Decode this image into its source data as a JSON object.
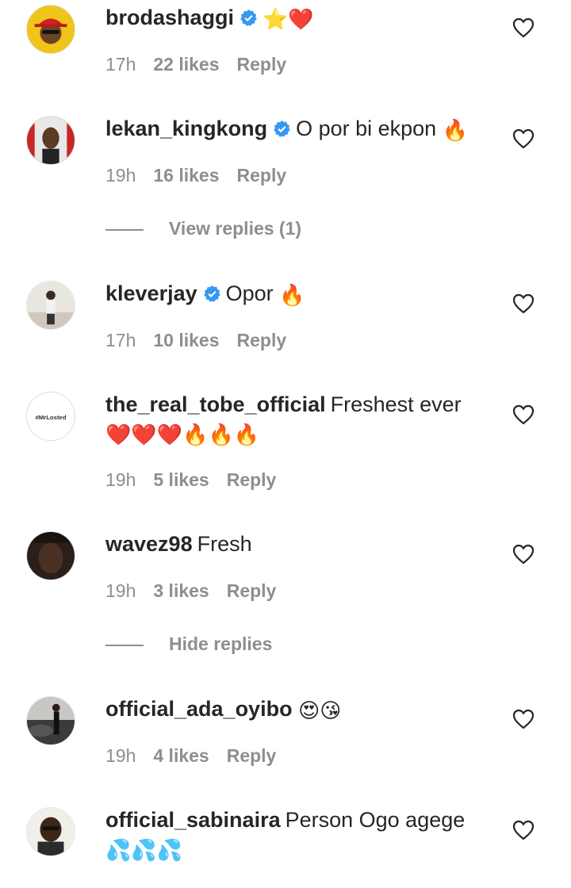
{
  "comments": [
    {
      "username": "brodashaggi",
      "verified": true,
      "text": "",
      "emoji": "⭐❤️",
      "emoji_line2": "",
      "time": "17h",
      "likes": "22 likes",
      "reply": "Reply"
    },
    {
      "username": "lekan_kingkong",
      "verified": true,
      "text": "O por bi ekpon",
      "emoji": "🔥",
      "emoji_line2": "",
      "time": "19h",
      "likes": "16 likes",
      "reply": "Reply"
    },
    {
      "username": "kleverjay",
      "verified": true,
      "text": "Opor",
      "emoji": "🔥",
      "emoji_line2": "",
      "time": "17h",
      "likes": "10 likes",
      "reply": "Reply"
    },
    {
      "username": "the_real_tobe_official",
      "verified": false,
      "text": "Freshest ever",
      "emoji": "",
      "emoji_line2": "❤️❤️❤️🔥🔥🔥",
      "time": "19h",
      "likes": "5 likes",
      "reply": "Reply",
      "avatar_text": "#MrLosted"
    },
    {
      "username": "wavez98",
      "verified": false,
      "text": "Fresh",
      "emoji": "",
      "emoji_line2": "",
      "time": "19h",
      "likes": "3 likes",
      "reply": "Reply"
    },
    {
      "username": "official_ada_oyibo",
      "verified": false,
      "text": "",
      "emoji": "😍😘",
      "emoji_line2": "",
      "time": "19h",
      "likes": "4 likes",
      "reply": "Reply"
    },
    {
      "username": "official_sabinaira",
      "verified": false,
      "text": "Person Ogo agege",
      "emoji": "",
      "emoji_line2": "💦💦💦",
      "time": "",
      "likes": "",
      "reply": ""
    }
  ],
  "view_replies": "View replies (1)",
  "hide_replies": "Hide replies",
  "colors": {
    "text": "#262626",
    "muted": "#8e8e8e",
    "verified": "#3897f0",
    "heart_stroke": "#262626"
  }
}
